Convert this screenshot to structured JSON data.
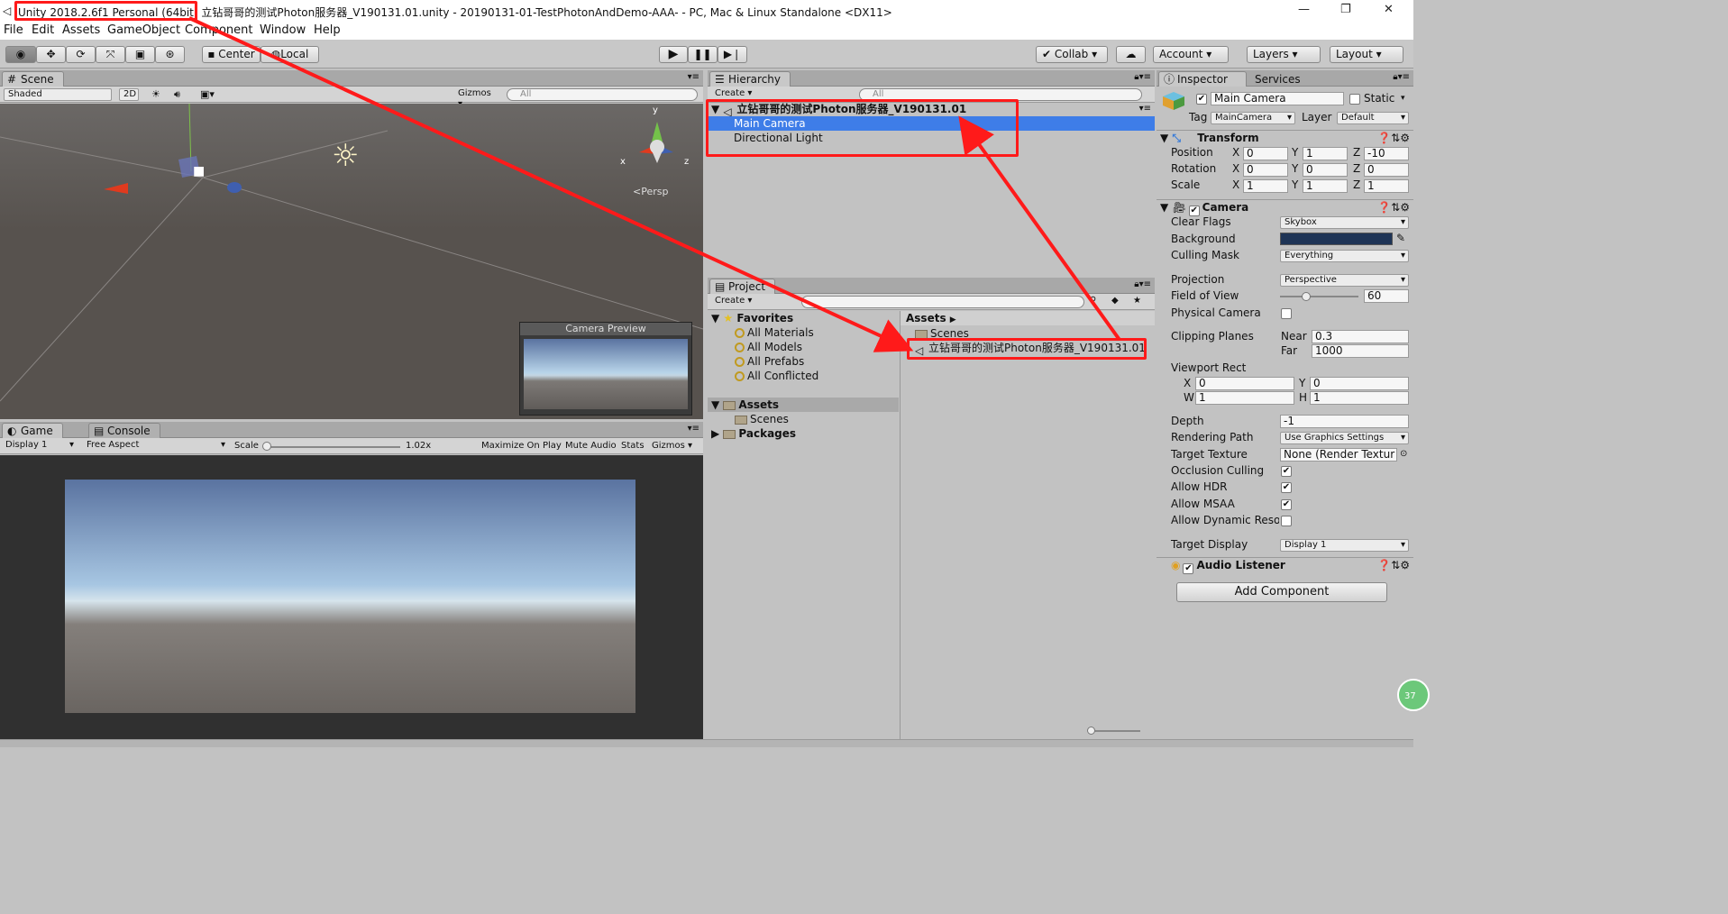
{
  "window": {
    "unity_version": "Unity 2018.2.6f1 Personal (64bit)",
    "title_rest": "立钻哥哥的测试Photon服务器_V190131.01.unity - 20190131-01-TestPhotonAndDemo-AAA- - PC, Mac & Linux Standalone <DX11>"
  },
  "menu": [
    "File",
    "Edit",
    "Assets",
    "GameObject",
    "Component",
    "Window",
    "Help"
  ],
  "toolbar": {
    "pivot": "Center",
    "space": "Local",
    "collab": "Collab",
    "account": "Account",
    "layers": "Layers",
    "layout": "Layout"
  },
  "scene": {
    "tab": "Scene",
    "shading": "Shaded",
    "mode2d": "2D",
    "gizmos": "Gizmos",
    "search_placeholder": "All",
    "persp": "Persp",
    "axis_x": "x",
    "axis_y": "y",
    "axis_z": "z",
    "camera_preview": "Camera Preview"
  },
  "game": {
    "tab": "Game",
    "console_tab": "Console",
    "display": "Display 1",
    "aspect": "Free Aspect",
    "scale_label": "Scale",
    "scale_value": "1.02x",
    "maximize": "Maximize On Play",
    "mute": "Mute Audio",
    "stats": "Stats",
    "gizmos": "Gizmos"
  },
  "hierarchy": {
    "tab": "Hierarchy",
    "create": "Create",
    "search_placeholder": "All",
    "scene_name": "立钻哥哥的测试Photon服务器_V190131.01",
    "items": [
      "Main Camera",
      "Directional Light"
    ]
  },
  "project": {
    "tab": "Project",
    "create": "Create",
    "favorites": "Favorites",
    "favorite_items": [
      "All Materials",
      "All Models",
      "All Prefabs",
      "All Conflicted"
    ],
    "assets": "Assets",
    "scenes": "Scenes",
    "packages": "Packages",
    "breadcrumb": "Assets",
    "files": [
      "Scenes",
      "立钻哥哥的测试Photon服务器_V190131.01"
    ]
  },
  "inspector": {
    "tab": "Inspector",
    "services_tab": "Services",
    "object_name": "Main Camera",
    "static": "Static",
    "tag_label": "Tag",
    "tag": "MainCamera",
    "layer_label": "Layer",
    "layer": "Default",
    "transform": {
      "title": "Transform",
      "position_label": "Position",
      "rotation_label": "Rotation",
      "scale_label": "Scale",
      "position": [
        "0",
        "1",
        "-10"
      ],
      "rotation": [
        "0",
        "0",
        "0"
      ],
      "scale": [
        "1",
        "1",
        "1"
      ]
    },
    "camera": {
      "title": "Camera",
      "clear_flags_label": "Clear Flags",
      "clear_flags": "Skybox",
      "background_label": "Background",
      "background_color": "#1e3456",
      "culling_mask_label": "Culling Mask",
      "culling_mask": "Everything",
      "projection_label": "Projection",
      "projection": "Perspective",
      "fov_label": "Field of View",
      "fov": "60",
      "fov_fraction": 0.33,
      "physical_label": "Physical Camera",
      "clipping_label": "Clipping Planes",
      "near_label": "Near",
      "near": "0.3",
      "far_label": "Far",
      "far": "1000",
      "viewport_label": "Viewport Rect",
      "vx": "0",
      "vy": "0",
      "vw": "1",
      "vh": "1",
      "depth_label": "Depth",
      "depth": "-1",
      "rendering_path_label": "Rendering Path",
      "rendering_path": "Use Graphics Settings",
      "target_texture_label": "Target Texture",
      "target_texture": "None (Render Textur",
      "occlusion_label": "Occlusion Culling",
      "hdr_label": "Allow HDR",
      "msaa_label": "Allow MSAA",
      "dynamic_label": "Allow Dynamic Resolu",
      "target_display_label": "Target Display",
      "target_display": "Display 1"
    },
    "audio_listener": "Audio Listener",
    "add_component": "Add Component",
    "corner_badge": "37"
  },
  "colors": {
    "highlight": "#ff1a1a",
    "selection": "#3e7de8"
  }
}
